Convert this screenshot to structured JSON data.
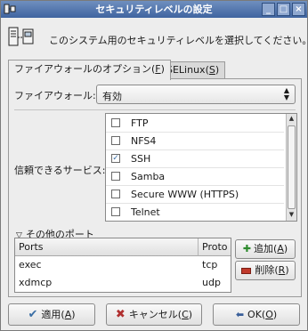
{
  "window": {
    "title": "セキュリティレベルの設定",
    "controls": [
      "_",
      "□",
      "×"
    ]
  },
  "header": {
    "text": "このシステム用のセキュリティレベルを選択してください。"
  },
  "tabs": [
    {
      "label": "ファイアウォールのオプション(",
      "mnemonic": "F",
      "close": ")",
      "active": true
    },
    {
      "label": "SELinux(",
      "mnemonic": "S",
      "close": ")",
      "active": false
    }
  ],
  "firewall": {
    "label": "ファイアウォール:",
    "value": "有効"
  },
  "services": {
    "label": "信頼できるサービス:",
    "items": [
      {
        "name": "FTP",
        "checked": false
      },
      {
        "name": "NFS4",
        "checked": false
      },
      {
        "name": "SSH",
        "checked": true
      },
      {
        "name": "Samba",
        "checked": false
      },
      {
        "name": "Secure WWW (HTTPS)",
        "checked": false
      },
      {
        "name": "Telnet",
        "checked": false
      }
    ]
  },
  "other_ports": {
    "expander_label": "その他のポート",
    "columns": [
      "Ports",
      "Proto"
    ],
    "rows": [
      {
        "port": "exec",
        "proto": "tcp"
      },
      {
        "port": "xdmcp",
        "proto": "udp"
      }
    ],
    "add_label": "追加(",
    "add_mnemonic": "A",
    "remove_label": "削除(",
    "remove_mnemonic": "R"
  },
  "buttons": {
    "apply_label": "適用(",
    "apply_mnemonic": "A",
    "cancel_label": "キャンセル(",
    "cancel_mnemonic": "C",
    "ok_label": "OK(",
    "ok_mnemonic": "O",
    "close_paren": ")"
  },
  "icons": {
    "title": "firewall-app-icon",
    "header": "firewall-icon",
    "check": "check-icon",
    "cross": "cancel-icon",
    "ok": "ok-icon",
    "add": "add-icon",
    "remove": "remove-icon"
  },
  "colors": {
    "titlebar": "#3f64a0",
    "check_accent": "#3a6ea5",
    "add_accent": "#2e8b2e",
    "remove_accent": "#c0392b"
  }
}
